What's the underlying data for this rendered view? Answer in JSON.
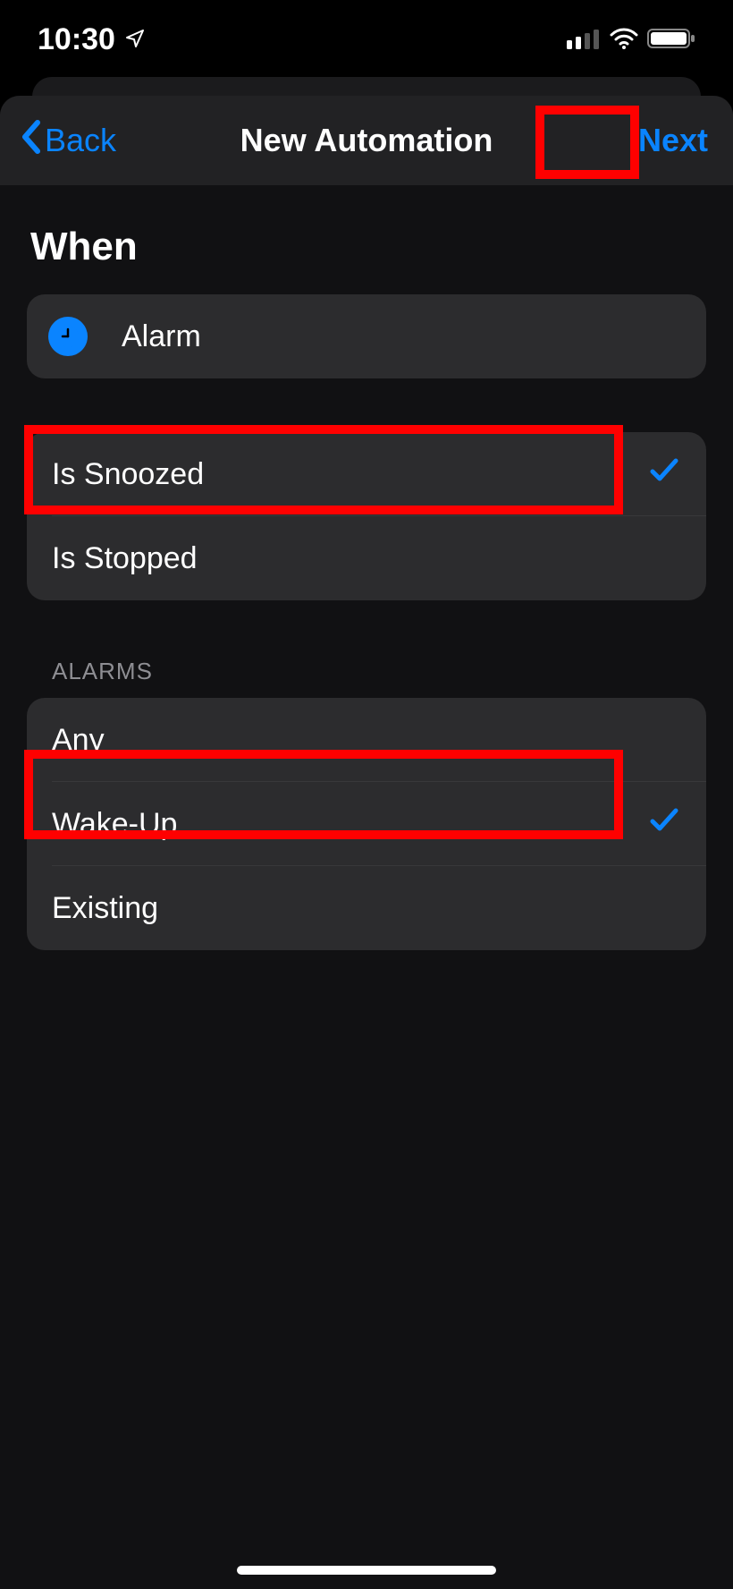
{
  "status": {
    "time": "10:30",
    "location_icon": "location-arrow",
    "signal_bars": 2,
    "wifi": true,
    "battery": "full"
  },
  "nav": {
    "back_label": "Back",
    "title": "New Automation",
    "next_label": "Next"
  },
  "when": {
    "heading": "When",
    "trigger_label": "Alarm"
  },
  "condition": {
    "options": [
      {
        "label": "Is Snoozed",
        "selected": true
      },
      {
        "label": "Is Stopped",
        "selected": false
      }
    ]
  },
  "alarms": {
    "header": "ALARMS",
    "options": [
      {
        "label": "Any",
        "selected": false
      },
      {
        "label": "Wake-Up",
        "selected": true
      },
      {
        "label": "Existing",
        "selected": false
      }
    ]
  }
}
